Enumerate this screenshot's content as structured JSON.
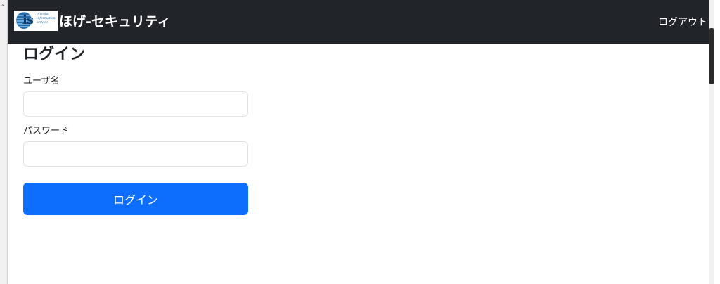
{
  "navbar": {
    "brand_title": "ほげ-セキュリティ",
    "logo": {
      "letters": "is",
      "tagline": "oriental information service"
    },
    "logout_label": "ログアウト"
  },
  "login_form": {
    "title": "ログイン",
    "username_label": "ユーザ名",
    "username_value": "",
    "password_label": "パスワード",
    "password_value": "",
    "submit_label": "ログイン"
  },
  "colors": {
    "navbar_bg": "#212529",
    "primary": "#0d6efd",
    "input_border": "#dee2e6"
  }
}
